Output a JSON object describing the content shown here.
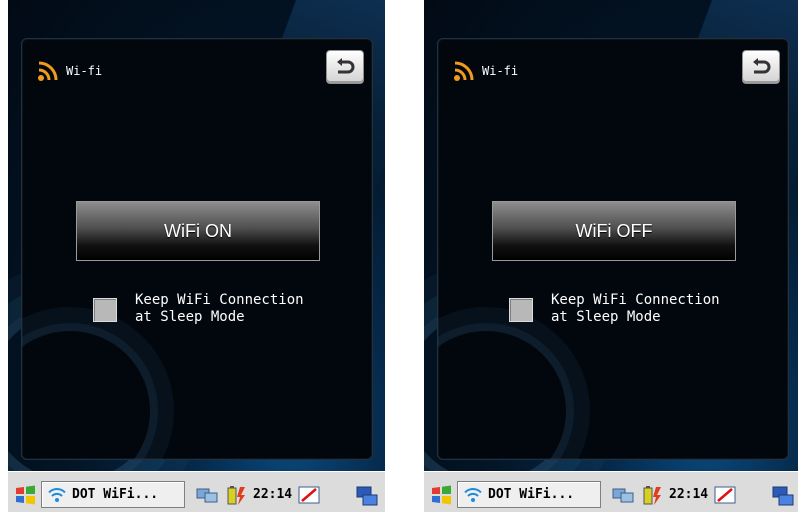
{
  "screens": [
    {
      "panel_title": "Wi-fi",
      "wifi_button_label": "WiFi ON",
      "checkbox_line1": "Keep WiFi Connection",
      "checkbox_line2": "at Sleep Mode",
      "taskbar": {
        "task_label": "DOT WiFi...",
        "clock": "22:14"
      }
    },
    {
      "panel_title": "Wi-fi",
      "wifi_button_label": "WiFi OFF",
      "checkbox_line1": "Keep WiFi Connection",
      "checkbox_line2": "at Sleep Mode",
      "taskbar": {
        "task_label": "DOT WiFi...",
        "clock": "22:14"
      }
    }
  ],
  "icons": {
    "panel": [
      "rss-wifi-icon",
      "back-arrow-icon"
    ],
    "taskbar": [
      "windows-start-icon",
      "wifi-signal-icon",
      "network-icon",
      "battery-icon",
      "pen-input-icon",
      "window-switch-icon"
    ]
  },
  "colors": {
    "accent_orange": "#f39b1a",
    "panel_bg": "#02070e",
    "taskbar_bg": "#dcdcdc"
  }
}
